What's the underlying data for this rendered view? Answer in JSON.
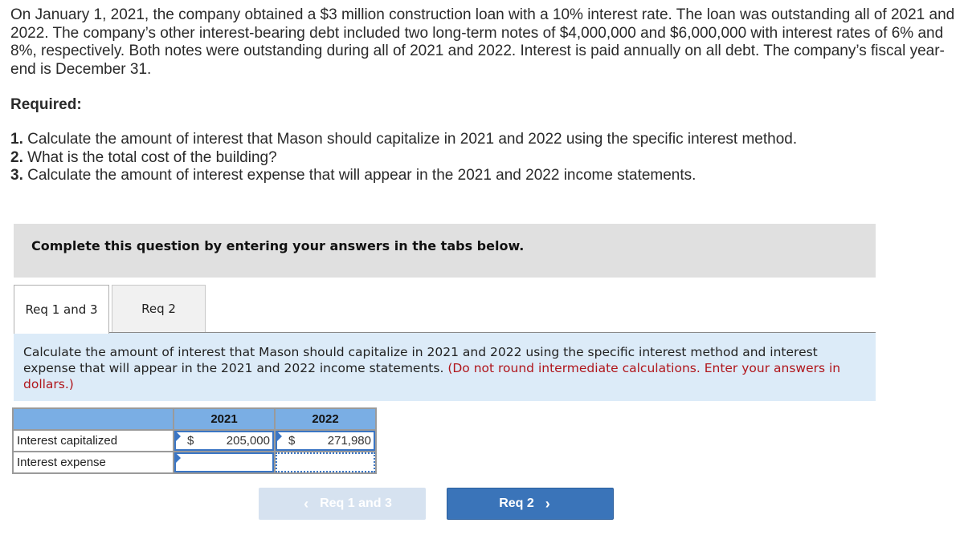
{
  "problem": {
    "text": "On January 1, 2021, the company obtained a $3 million construction loan with a 10% interest rate. The loan was outstanding all of 2021 and 2022. The company’s other interest-bearing debt included two long-term notes of $4,000,000 and $6,000,000 with interest rates of 6% and 8%, respectively. Both notes were outstanding during all of 2021 and 2022. Interest is paid annually on all debt. The company’s fiscal year-end is December 31."
  },
  "required": {
    "title": "Required:",
    "items": [
      {
        "num": "1.",
        "text": " Calculate the amount of interest that Mason should capitalize in 2021 and 2022 using the specific interest method."
      },
      {
        "num": "2.",
        "text": " What is the total cost of the building?"
      },
      {
        "num": "3.",
        "text": " Calculate the amount of interest expense that will appear in the 2021 and 2022 income statements."
      }
    ]
  },
  "instruction_box": "Complete this question by entering your answers in the tabs below.",
  "tabs": [
    {
      "label": "Req 1 and 3",
      "active": true
    },
    {
      "label": "Req 2",
      "active": false
    }
  ],
  "panel": {
    "text": "Calculate the amount of interest that Mason should capitalize in 2021 and 2022 using the specific interest method and interest expense that will appear in the 2021 and 2022 income statements.",
    "note": "(Do not round intermediate calculations. Enter your answers in dollars.)"
  },
  "table": {
    "columns": [
      "",
      "2021",
      "2022"
    ],
    "rows": [
      {
        "label": "Interest capitalized",
        "cells": [
          {
            "prefix": "$",
            "value": "205,000"
          },
          {
            "prefix": "$",
            "value": "271,980"
          }
        ]
      },
      {
        "label": "Interest expense",
        "cells": [
          {
            "prefix": "",
            "value": ""
          },
          {
            "prefix": "",
            "value": ""
          }
        ]
      }
    ]
  },
  "nav": {
    "prev_label": "Req 1 and 3",
    "next_label": "Req 2",
    "prev_icon": "chevron-left-icon",
    "next_icon": "chevron-right-icon"
  },
  "colors": {
    "header_blue": "#7aaee4",
    "panel_bg": "#dcebf8",
    "note_red": "#b0161c",
    "next_button": "#3a74b9",
    "prev_button_disabled": "#d6e2f0"
  }
}
